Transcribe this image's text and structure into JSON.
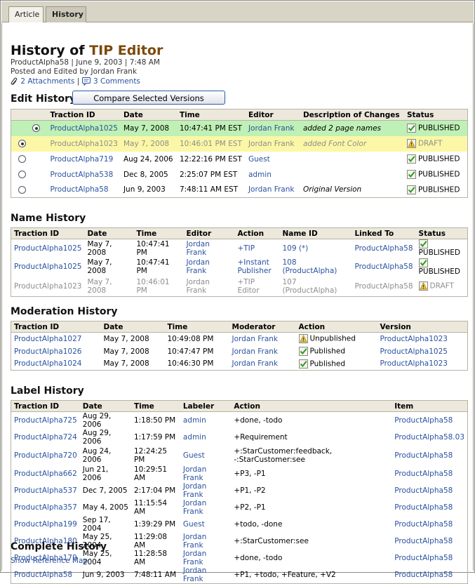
{
  "tabs": [
    {
      "label": "Article"
    },
    {
      "label": "History"
    }
  ],
  "title": {
    "prefix": "History of ",
    "accent": "TIP Editor"
  },
  "meta": {
    "line1": "ProductAlpha58 | June 9, 2003 | 7:48 AM",
    "line2": "Posted and Edited by Jordan Frank",
    "attachments": "2 Attachments",
    "separator": "|",
    "comments": "3 Comments"
  },
  "edit_history": {
    "heading": "Edit History",
    "compare_label": "Compare Selected Versions",
    "headers": [
      "Traction ID",
      "Date",
      "Time",
      "Editor",
      "Description of Changes",
      "Status"
    ],
    "rows": [
      {
        "radio": "on",
        "id": "ProductAlpha1025",
        "date": "May 7, 2008",
        "time": "10:47:41 PM EST",
        "editor": "Jordan Frank",
        "desc": "added 2 page names",
        "status": "PUBLISHED"
      },
      {
        "radio": "on",
        "id": "ProductAlpha1023",
        "date": "May 7, 2008",
        "time": "10:46:01 PM EST",
        "editor": "Jordan Frank",
        "desc": "added Font Color",
        "status": "DRAFT"
      },
      {
        "radio": "off",
        "id": "ProductAlpha719",
        "date": "Aug 24, 2006",
        "time": "12:22:16 PM EST",
        "editor": "Guest",
        "desc": "",
        "status": "PUBLISHED"
      },
      {
        "radio": "off",
        "id": "ProductAlpha538",
        "date": "Dec 8, 2005",
        "time": "2:25:07 PM EST",
        "editor": "admin",
        "desc": "",
        "status": "PUBLISHED"
      },
      {
        "radio": "off",
        "id": "ProductAlpha58",
        "date": "Jun 9, 2003",
        "time": "7:48:11 AM EST",
        "editor": "Jordan Frank",
        "desc": "Original Version",
        "status": "PUBLISHED"
      }
    ]
  },
  "name_history": {
    "heading": "Name History",
    "headers": [
      "Traction ID",
      "Date",
      "Time",
      "Editor",
      "Action",
      "Name ID",
      "Linked To",
      "Status"
    ],
    "rows": [
      {
        "id": "ProductAlpha1025",
        "date": "May 7, 2008",
        "time": "10:47:41 PM",
        "editor": "Jordan Frank",
        "action": "+TIP",
        "name_id": "109 (*)",
        "linked": "ProductAlpha58",
        "status": "PUBLISHED"
      },
      {
        "id": "ProductAlpha1025",
        "date": "May 7, 2008",
        "time": "10:47:41 PM",
        "editor": "Jordan Frank",
        "action": "+Instant Publisher",
        "name_id": "108 (ProductAlpha)",
        "linked": "ProductAlpha58",
        "status": "PUBLISHED"
      },
      {
        "id": "ProductAlpha1023",
        "date": "May 7, 2008",
        "time": "10:46:01 PM",
        "editor": "Jordan Frank",
        "action": "+TIP Editor",
        "name_id": "107 (ProductAlpha)",
        "linked": "ProductAlpha58",
        "status": "DRAFT"
      }
    ]
  },
  "moderation_history": {
    "heading": "Moderation History",
    "headers": [
      "Traction ID",
      "Date",
      "Time",
      "Moderator",
      "Action",
      "Version"
    ],
    "rows": [
      {
        "id": "ProductAlpha1027",
        "date": "May 7, 2008",
        "time": "10:49:08 PM",
        "moderator": "Jordan Frank",
        "action": "Unpublished",
        "version": "ProductAlpha1023"
      },
      {
        "id": "ProductAlpha1026",
        "date": "May 7, 2008",
        "time": "10:47:47 PM",
        "moderator": "Jordan Frank",
        "action": "Published",
        "version": "ProductAlpha1025"
      },
      {
        "id": "ProductAlpha1024",
        "date": "May 7, 2008",
        "time": "10:46:30 PM",
        "moderator": "Jordan Frank",
        "action": "Published",
        "version": "ProductAlpha1023"
      }
    ]
  },
  "label_history": {
    "heading": "Label History",
    "headers": [
      "Traction ID",
      "Date",
      "Time",
      "Labeler",
      "Action",
      "Item"
    ],
    "rows": [
      {
        "id": "ProductAlpha725",
        "date": "Aug 29, 2006",
        "time": "1:18:50 PM",
        "labeler": "admin",
        "action": "+done, -todo",
        "item": "ProductAlpha58"
      },
      {
        "id": "ProductAlpha724",
        "date": "Aug 29, 2006",
        "time": "1:17:59 PM",
        "labeler": "admin",
        "action": "+Requirement",
        "item": "ProductAlpha58.03"
      },
      {
        "id": "ProductAlpha720",
        "date": "Aug 24, 2006",
        "time": "12:24:25 PM",
        "labeler": "Guest",
        "action": "+:StarCustomer:feedback, -:StarCustomer:see",
        "item": "ProductAlpha58"
      },
      {
        "id": "ProductAlpha662",
        "date": "Jun 21, 2006",
        "time": "10:29:51 AM",
        "labeler": "Jordan Frank",
        "action": "+P3, -P1",
        "item": "ProductAlpha58"
      },
      {
        "id": "ProductAlpha537",
        "date": "Dec 7, 2005",
        "time": "2:17:04 PM",
        "labeler": "Jordan Frank",
        "action": "+P1, -P2",
        "item": "ProductAlpha58"
      },
      {
        "id": "ProductAlpha357",
        "date": "May 4, 2005",
        "time": "11:15:54 AM",
        "labeler": "Jordan Frank",
        "action": "+P2, -P1",
        "item": "ProductAlpha58"
      },
      {
        "id": "ProductAlpha199",
        "date": "Sep 17, 2004",
        "time": "1:39:29 PM",
        "labeler": "Guest",
        "action": "+todo, -done",
        "item": "ProductAlpha58"
      },
      {
        "id": "ProductAlpha180",
        "date": "May 25, 2004",
        "time": "11:29:08 AM",
        "labeler": "Jordan Frank",
        "action": "+:StarCustomer:see",
        "item": "ProductAlpha58"
      },
      {
        "id": "ProductAlpha179",
        "date": "May 25, 2004",
        "time": "11:28:58 AM",
        "labeler": "Jordan Frank",
        "action": "+done, -todo",
        "item": "ProductAlpha58"
      },
      {
        "id": "ProductAlpha58",
        "date": "Jun 9, 2003",
        "time": "7:48:11 AM",
        "labeler": "Jordan Frank",
        "action": "+P1, +todo, +Feature, +V2",
        "item": "ProductAlpha58"
      }
    ]
  },
  "complete_history": {
    "heading": "Complete History",
    "link": "Show Reference Map"
  },
  "colors": {
    "accent": "#7a4a0c",
    "link": "#2a52a0",
    "published_row": "#bff0b5",
    "draft_row": "#fbf7a6"
  }
}
